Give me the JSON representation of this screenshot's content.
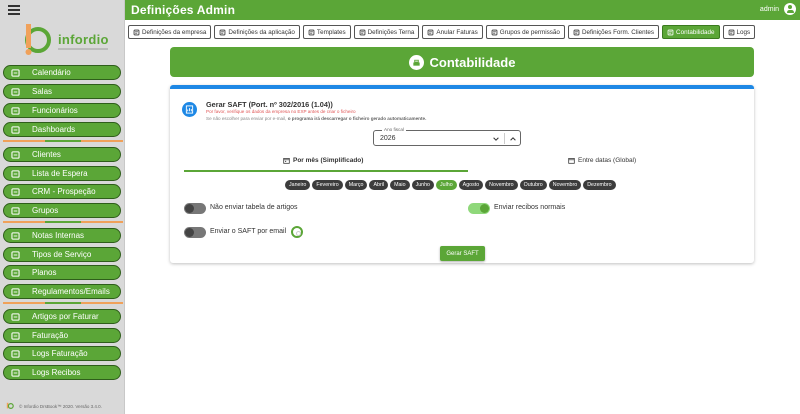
{
  "sidebar": {
    "logo_text": "infordio",
    "items": [
      {
        "label": "Calendário",
        "icon": "calendar-icon"
      },
      {
        "label": "Salas",
        "icon": "room-icon"
      },
      {
        "label": "Funcionários",
        "icon": "staff-icon"
      },
      {
        "label": "Dashboards",
        "icon": "dashboard-icon"
      },
      {
        "label": "Clientes",
        "icon": "clients-icon"
      },
      {
        "label": "Lista de Espera",
        "icon": "clock-icon"
      },
      {
        "label": "CRM - Prospeção",
        "icon": "crm-icon"
      },
      {
        "label": "Grupos",
        "icon": "groups-icon"
      },
      {
        "label": "Notas Internas",
        "icon": "notes-icon"
      },
      {
        "label": "Tipos de Serviço",
        "icon": "services-icon"
      },
      {
        "label": "Planos",
        "icon": "plans-icon"
      },
      {
        "label": "Regulamentos/Emails",
        "icon": "rules-icon"
      },
      {
        "label": "Artigos por Faturar",
        "icon": "articles-icon"
      },
      {
        "label": "Faturação",
        "icon": "invoice-icon"
      },
      {
        "label": "Logs Faturação",
        "icon": "logs-icon"
      },
      {
        "label": "Logs Recibos",
        "icon": "receipts-icon"
      }
    ],
    "footer": "© Infordio DrsBook™ 2020. Versão 3.4.0."
  },
  "topbar": {
    "title": "Definições Admin",
    "user": "admin"
  },
  "tabs": [
    {
      "label": "Definições da empresa",
      "icon": "building-icon"
    },
    {
      "label": "Definições da aplicação",
      "icon": "app-icon"
    },
    {
      "label": "Templates",
      "icon": "template-icon"
    },
    {
      "label": "Definições Terna",
      "icon": "tools-icon"
    },
    {
      "label": "Anular Faturas",
      "icon": "file-icon"
    },
    {
      "label": "Grupos de permissão",
      "icon": "groups-icon"
    },
    {
      "label": "Definições Form. Clientes",
      "icon": "user-circle-icon"
    },
    {
      "label": "Contabilidade",
      "icon": "accounting-icon"
    },
    {
      "label": "Logs",
      "icon": "list-icon"
    }
  ],
  "active_tab": "Contabilidade",
  "banner": {
    "title": "Contabilidade"
  },
  "saft": {
    "title": "Gerar SAFT (Port. nº 302/2016 (1.04))",
    "warning": "Por favor, verifique os dados da empresa no EXP antes de criar o ficheiro",
    "note_start": "Se não escolher para enviar por e-mail, ",
    "note_bold": "o programa irá descarregar o ficheiro gerado automaticamente."
  },
  "year": {
    "label": "Ano fiscal",
    "value": "2026"
  },
  "modes": {
    "monthly": "Por mês (Simplificado)",
    "range": "Entre datas (Global)"
  },
  "months": [
    "Janeiro",
    "Fevereiro",
    "Março",
    "Abril",
    "Maio",
    "Junho",
    "Julho",
    "Agosto",
    "Novembro",
    "Outubro",
    "Novembro",
    "Dezembro"
  ],
  "selected_month_index": 6,
  "options": {
    "no_articles": "Não enviar tabela de artigos",
    "send_receipts": "Enviar recibos normais",
    "send_email": "Enviar o SAFT por email"
  },
  "generate_button": "Gerar SAFT",
  "colors": {
    "primary": "#5ba637",
    "accent_blue": "#1e88e5",
    "separator_orange": "#f0a15a"
  }
}
